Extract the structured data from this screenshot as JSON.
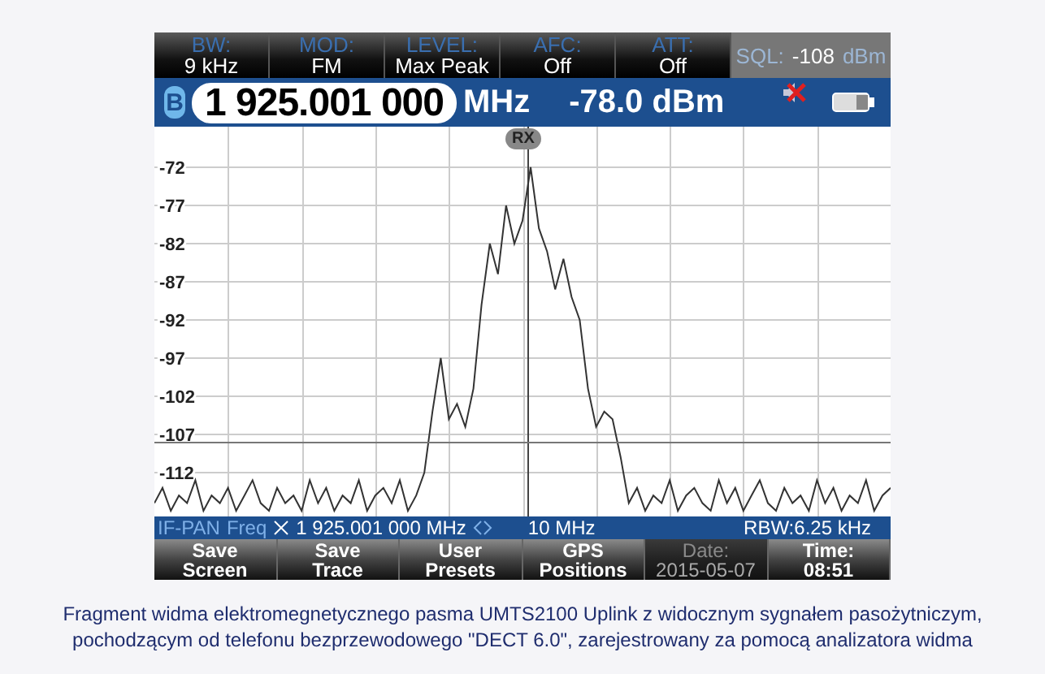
{
  "header": {
    "settings": [
      {
        "label": "BW:",
        "value": "9 kHz"
      },
      {
        "label": "MOD:",
        "value": "FM"
      },
      {
        "label": "LEVEL:",
        "value": "Max Peak"
      },
      {
        "label": "AFC:",
        "value": "Off"
      },
      {
        "label": "ATT:",
        "value": "Off"
      }
    ],
    "squelch": {
      "label": "SQL:",
      "value": "-108",
      "unit": "dBm"
    }
  },
  "frequency_bar": {
    "band": "B",
    "frequency": "1 925.001 000",
    "unit": "MHz",
    "power": "-78.0 dBm",
    "muted": true
  },
  "plot": {
    "marker": "RX",
    "chart_data": {
      "type": "line",
      "grid": true,
      "ylim": [
        -117.74,
        -66.68
      ],
      "yticks": [
        -72,
        -77,
        -82,
        -87,
        -92,
        -97,
        -102,
        -107,
        -112
      ],
      "values": [
        -116,
        -114,
        -117,
        -115,
        -116,
        -113,
        -117,
        -115,
        -116,
        -114,
        -117,
        -115,
        -113,
        -116,
        -117,
        -114,
        -116,
        -115,
        -117,
        -113,
        -116,
        -114,
        -117,
        -115,
        -116,
        -113,
        -117,
        -115,
        -114,
        -116,
        -113,
        -117,
        -115,
        -112,
        -104,
        -97,
        -105,
        -103,
        -106,
        -101,
        -90,
        -82,
        -86,
        -77,
        -82,
        -79,
        -72,
        -80,
        -83,
        -88,
        -84,
        -89,
        -92,
        -101,
        -106,
        -104,
        -105,
        -110,
        -116,
        -114,
        -117,
        -115,
        -116,
        -113,
        -117,
        -115,
        -114,
        -116,
        -117,
        -113,
        -116,
        -114,
        -117,
        -115,
        -113,
        -116,
        -117,
        -114,
        -116,
        -115,
        -117,
        -113,
        -116,
        -114,
        -117,
        -115,
        -116,
        -113,
        -117,
        -115,
        -114
      ]
    }
  },
  "status_bar": {
    "mode": "IF-PAN",
    "parameter": "Freq",
    "center": "1 925.001 000 MHz",
    "span": "10 MHz",
    "rbw": "RBW:6.25 kHz"
  },
  "softkeys": [
    {
      "line1": "Save",
      "line2": "Screen",
      "disabled": false
    },
    {
      "line1": "Save",
      "line2": "Trace",
      "disabled": false
    },
    {
      "line1": "User",
      "line2": "Presets",
      "disabled": false
    },
    {
      "line1": "GPS",
      "line2": "Positions",
      "disabled": false
    },
    {
      "line1": "Date:",
      "line2": "2015-05-07",
      "disabled": true
    },
    {
      "line1": "Time:",
      "line2": "08:51",
      "disabled": false
    }
  ],
  "caption": "Fragment widma elektromegnetycznego pasma UMTS2100 Uplink z widocznym sygnałem pasożytniczym, pochodzącym od telefonu bezprzewodowego \"DECT 6.0\", zarejestrowany za pomocą analizatora widma"
}
